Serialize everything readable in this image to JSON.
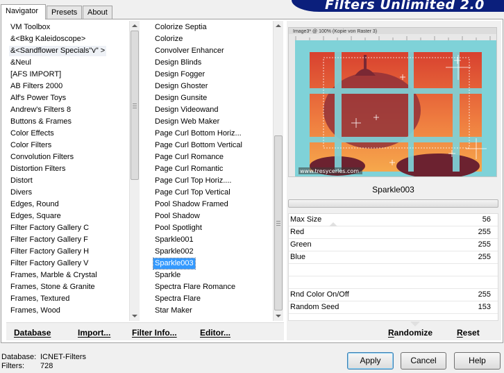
{
  "app": {
    "title": "Filters Unlimited 2.0"
  },
  "tabs": [
    {
      "label": "Navigator",
      "active": true
    },
    {
      "label": "Presets",
      "active": false
    },
    {
      "label": "About",
      "active": false
    }
  ],
  "categories": {
    "items": [
      "VM Toolbox",
      "&<Bkg Kaleidoscope>",
      "&<Sandflower Specials\"v\" >",
      "&Neul",
      "[AFS IMPORT]",
      "AB Filters 2000",
      "Alf's Power Toys",
      "Andrew's Filters 8",
      "Buttons & Frames",
      "Color Effects",
      "Color Filters",
      "Convolution Filters",
      "Distortion Filters",
      "Distort",
      "Divers",
      "Edges, Round",
      "Edges, Square",
      "Filter Factory Gallery C",
      "Filter Factory Gallery F",
      "Filter Factory Gallery H",
      "Filter Factory Gallery V",
      "Frames, Marble & Crystal",
      "Frames, Stone & Granite",
      "Frames, Textured",
      "Frames, Wood"
    ],
    "current_index": 2
  },
  "filters": {
    "items": [
      "Colorize Septia",
      "Colorize",
      "Convolver Enhancer",
      "Design Blinds",
      "Design Fogger",
      "Design Ghoster",
      "Design Gunsite",
      "Design Videowand",
      "Design Web Maker",
      "Page Curl Bottom Horiz...",
      "Page Curl Bottom Vertical",
      "Page Curl Romance",
      "Page Curl Romantic",
      "Page Curl Top Horiz....",
      "Page Curl Top Vertical",
      "Pool Shadow Framed",
      "Pool Shadow",
      "Pool Spotlight",
      "Sparkle001",
      "Sparkle002",
      "Sparkle003",
      "Sparkle",
      "Spectra Flare Romance",
      "Spectra Flare",
      "Star Maker"
    ],
    "selected_index": 20
  },
  "list_buttons": {
    "database": "Database",
    "import": "Import...",
    "filter_info": "Filter Info...",
    "editor": "Editor..."
  },
  "preview": {
    "caption": "Image3* @ 100% (Kopie von Raster 3)",
    "watermark": "www.tresycerles.com"
  },
  "selected_filter": {
    "name": "Sparkle003"
  },
  "parameters": [
    {
      "label": "Max Size",
      "value": "56"
    },
    {
      "label": "Red",
      "value": "255"
    },
    {
      "label": "Green",
      "value": "255"
    },
    {
      "label": "Blue",
      "value": "255"
    },
    {
      "label": "",
      "value": ""
    },
    {
      "label": "",
      "value": ""
    },
    {
      "label": "Rnd Color On/Off",
      "value": "255"
    },
    {
      "label": "Random Seed",
      "value": "153"
    }
  ],
  "param_buttons": {
    "randomize": "Randomize",
    "reset": "Reset"
  },
  "status": {
    "database_label": "Database:",
    "database_value": "ICNET-Filters",
    "filters_label": "Filters:",
    "filters_value": "728"
  },
  "dialog_buttons": {
    "apply": "Apply",
    "cancel": "Cancel",
    "help": "Help"
  },
  "colors": {
    "banner": "#0b1f7c",
    "selection": "#3399ff",
    "preview_frame": "#7fd2d8",
    "preview_sky_top": "#e04b3a",
    "preview_sky_bottom": "#f5a04a"
  }
}
